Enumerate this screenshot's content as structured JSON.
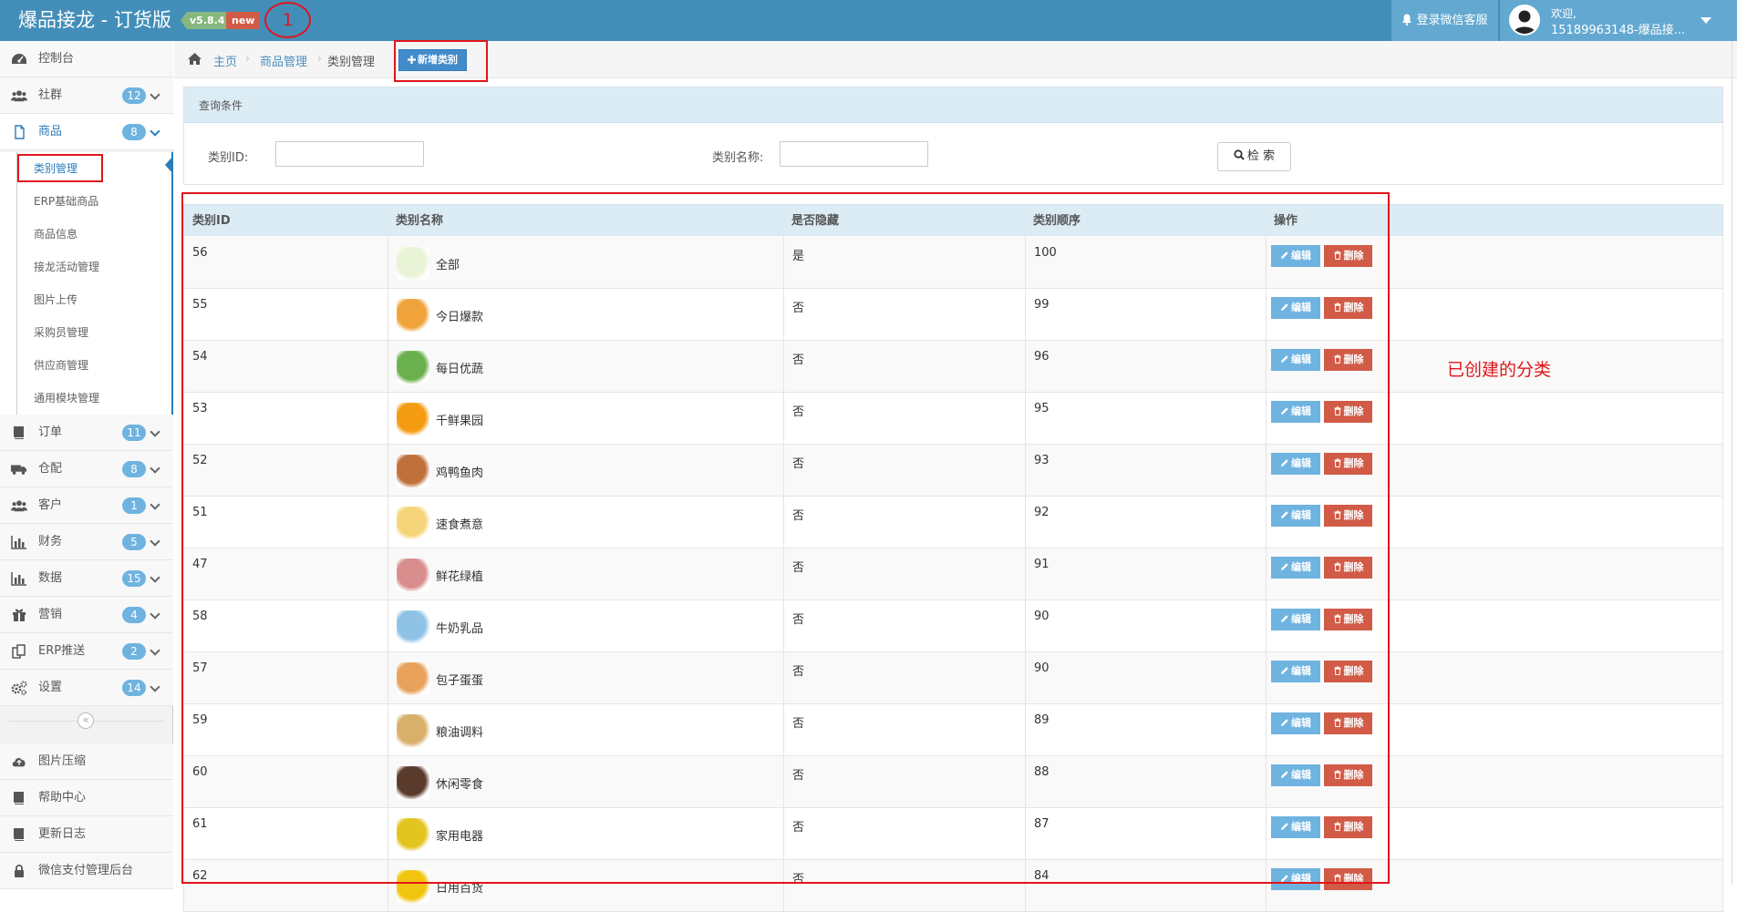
{
  "header": {
    "brand": "爆品接龙 - 订货版",
    "version": "v5.8.4",
    "new_tag": "new",
    "callout": "1",
    "support_label": "登录微信客服",
    "user_greeting": "欢迎,",
    "user_name": "15189963148-爆品接..."
  },
  "sidebar": {
    "items": [
      {
        "label": "控制台",
        "icon": "dashboard-icon"
      },
      {
        "label": "社群",
        "icon": "users-icon",
        "badge": "12"
      },
      {
        "label": "商品",
        "icon": "file-icon",
        "badge": "8"
      },
      {
        "label": "订单",
        "icon": "book-icon",
        "badge": "11"
      },
      {
        "label": "仓配",
        "icon": "truck-icon",
        "badge": "8"
      },
      {
        "label": "客户",
        "icon": "users-icon",
        "badge": "1"
      },
      {
        "label": "财务",
        "icon": "bar-chart-icon",
        "badge": "5"
      },
      {
        "label": "数据",
        "icon": "bar-chart-icon",
        "badge": "15"
      },
      {
        "label": "营销",
        "icon": "gift-icon",
        "badge": "4"
      },
      {
        "label": "ERP推送",
        "icon": "copy-icon",
        "badge": "2"
      },
      {
        "label": "设置",
        "icon": "cogs-icon",
        "badge": "14"
      },
      {
        "label": "图片压缩",
        "icon": "cloud-upload-icon"
      },
      {
        "label": "帮助中心",
        "icon": "book-icon"
      },
      {
        "label": "更新日志",
        "icon": "book-icon"
      },
      {
        "label": "微信支付管理后台",
        "icon": "lock-icon"
      }
    ],
    "submenu": [
      "类别管理",
      "ERP基础商品",
      "商品信息",
      "接龙活动管理",
      "图片上传",
      "采购员管理",
      "供应商管理",
      "通用模块管理"
    ],
    "collapse_glyph": "«"
  },
  "breadcrumb": {
    "home": "主页",
    "sep": "›",
    "level2": "商品管理",
    "current": "类别管理"
  },
  "add_button": "新增类别",
  "query": {
    "title": "查询条件",
    "id_label": "类别ID:",
    "name_label": "类别名称:",
    "id_value": "",
    "name_value": "",
    "search_label": "检 索"
  },
  "table": {
    "columns": [
      "类别ID",
      "类别名称",
      "是否隐藏",
      "类别顺序",
      "操作"
    ],
    "edit_label": "编辑",
    "delete_label": "删除",
    "rows": [
      {
        "id": "56",
        "name": "全部",
        "hidden": "是",
        "order": "100",
        "thumb": "#e9f3d6"
      },
      {
        "id": "55",
        "name": "今日爆款",
        "hidden": "否",
        "order": "99",
        "thumb": "#f0a33b"
      },
      {
        "id": "54",
        "name": "每日优蔬",
        "hidden": "否",
        "order": "96",
        "thumb": "#6ab04c"
      },
      {
        "id": "53",
        "name": "千鲜果园",
        "hidden": "否",
        "order": "95",
        "thumb": "#f39c12"
      },
      {
        "id": "52",
        "name": "鸡鸭鱼肉",
        "hidden": "否",
        "order": "93",
        "thumb": "#c0703a"
      },
      {
        "id": "51",
        "name": "速食煮意",
        "hidden": "否",
        "order": "92",
        "thumb": "#f6d57a"
      },
      {
        "id": "47",
        "name": "鲜花绿植",
        "hidden": "否",
        "order": "91",
        "thumb": "#d98c8c"
      },
      {
        "id": "58",
        "name": "牛奶乳品",
        "hidden": "否",
        "order": "90",
        "thumb": "#8ec3e6"
      },
      {
        "id": "57",
        "name": "包子蛋蛋",
        "hidden": "否",
        "order": "90",
        "thumb": "#e8a25c"
      },
      {
        "id": "59",
        "name": "粮油调料",
        "hidden": "否",
        "order": "89",
        "thumb": "#d8b06a"
      },
      {
        "id": "60",
        "name": "休闲零食",
        "hidden": "否",
        "order": "88",
        "thumb": "#5a3a2a"
      },
      {
        "id": "61",
        "name": "家用电器",
        "hidden": "否",
        "order": "87",
        "thumb": "#e3c51f"
      },
      {
        "id": "62",
        "name": "日用百货",
        "hidden": "否",
        "order": "84",
        "thumb": "#f1c40f"
      }
    ]
  },
  "annotation": "已创建的分类",
  "colors": {
    "header": "#438eb9",
    "accent": "#2b7dbc",
    "badge": "#6fb3e0",
    "edit": "#6fb3e0",
    "delete": "#d15b47",
    "callout_red": "#e0161b"
  }
}
